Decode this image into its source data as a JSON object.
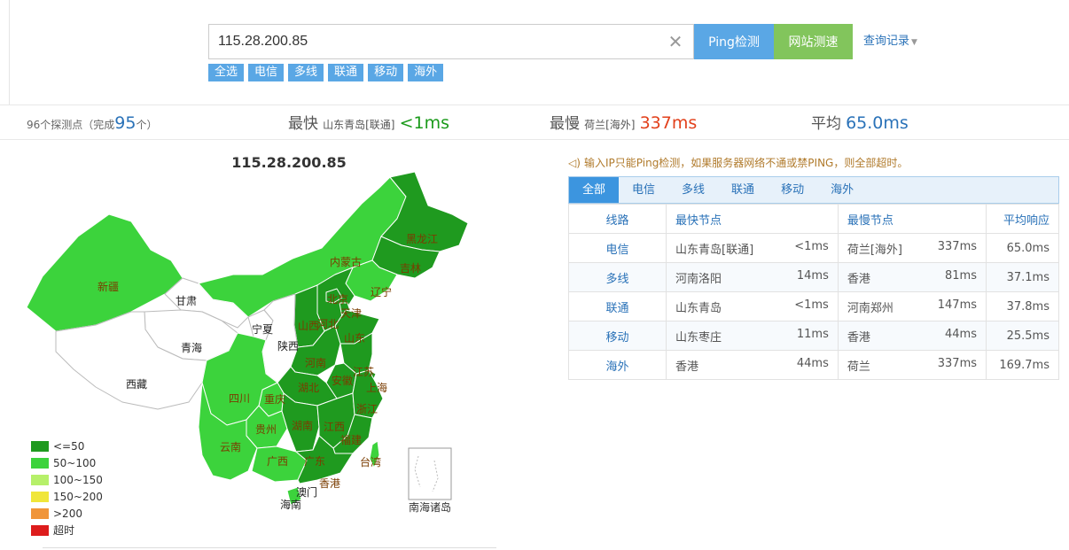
{
  "search": {
    "value": "115.28.200.85",
    "ping_button": "Ping检测",
    "web_button": "网站测速",
    "history_label": "查询记录"
  },
  "filters": [
    "全选",
    "电信",
    "多线",
    "联通",
    "移动",
    "海外"
  ],
  "stats": {
    "probe_prefix": "96个探测点（",
    "probe_done_label": "完成",
    "probe_done_count": "95",
    "probe_suffix": "个）",
    "fastest_label": "最快",
    "fastest_node": "山东青岛[联通]",
    "fastest_value": "<1ms",
    "slowest_label": "最慢",
    "slowest_node": "荷兰[海外]",
    "slowest_value": "337ms",
    "avg_label": "平均",
    "avg_value": "65.0ms"
  },
  "map": {
    "title": "115.28.200.85",
    "provinces": [
      "新疆",
      "甘肃",
      "青海",
      "西藏",
      "内蒙古",
      "黑龙江",
      "吉林",
      "辽宁",
      "北京",
      "天津",
      "河北",
      "宁夏",
      "陕西",
      "山西",
      "山东",
      "河南",
      "江苏",
      "安徽",
      "上海",
      "湖北",
      "四川",
      "重庆",
      "贵州",
      "湖南",
      "江西",
      "浙江",
      "云南",
      "广西",
      "广东",
      "福建",
      "台湾",
      "香港",
      "澳门",
      "海南",
      "南海诸岛"
    ],
    "colors": {
      "le50": "#1f9a1f",
      "le100": "#3cd33c",
      "none": "#ffffff"
    }
  },
  "legend": [
    {
      "label": "<=50",
      "color": "#1f9a1f"
    },
    {
      "label": "50~100",
      "color": "#3cd33c"
    },
    {
      "label": "100~150",
      "color": "#b6f06a"
    },
    {
      "label": "150~200",
      "color": "#f0e63a"
    },
    {
      "label": ">200",
      "color": "#f0953a"
    },
    {
      "label": "超时",
      "color": "#dd1c1c"
    }
  ],
  "notice": "输入IP只能Ping检测，如果服务器网络不通或禁PING，则全部超时。",
  "tabs": [
    "全部",
    "电信",
    "多线",
    "联通",
    "移动",
    "海外"
  ],
  "table": {
    "headers": [
      "线路",
      "最快节点",
      "最慢节点",
      "平均响应"
    ],
    "rows": [
      {
        "line": "电信",
        "fast_node": "山东青岛[联通]",
        "fast_ms": "<1ms",
        "slow_node": "荷兰[海外]",
        "slow_ms": "337ms",
        "avg": "65.0ms"
      },
      {
        "line": "多线",
        "fast_node": "河南洛阳",
        "fast_ms": "14ms",
        "slow_node": "香港",
        "slow_ms": "81ms",
        "avg": "37.1ms"
      },
      {
        "line": "联通",
        "fast_node": "山东青岛",
        "fast_ms": "<1ms",
        "slow_node": "河南郑州",
        "slow_ms": "147ms",
        "avg": "37.8ms"
      },
      {
        "line": "移动",
        "fast_node": "山东枣庄",
        "fast_ms": "11ms",
        "slow_node": "香港",
        "slow_ms": "44ms",
        "avg": "25.5ms"
      },
      {
        "line": "海外",
        "fast_node": "香港",
        "fast_ms": "44ms",
        "slow_node": "荷兰",
        "slow_ms": "337ms",
        "avg": "169.7ms"
      }
    ]
  }
}
